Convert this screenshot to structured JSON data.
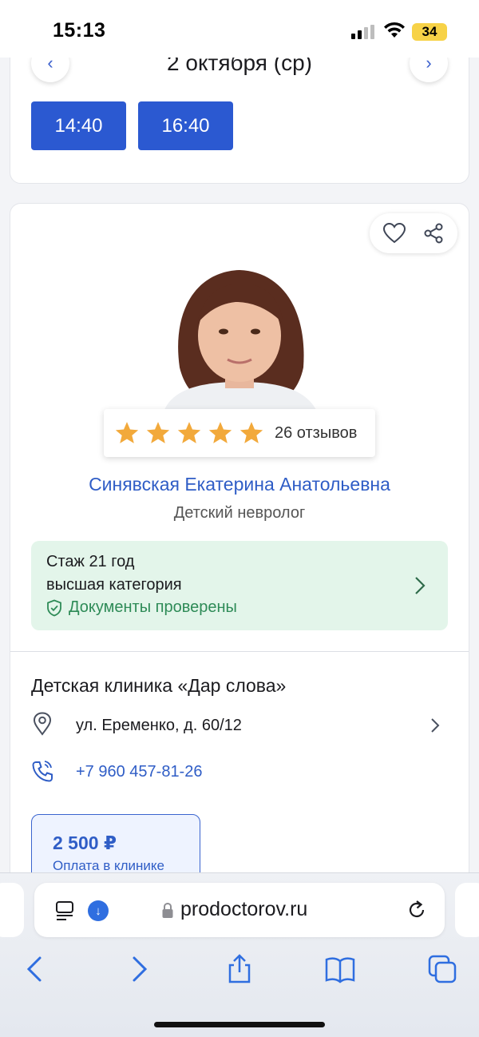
{
  "status": {
    "time": "15:13",
    "battery": "34"
  },
  "schedule": {
    "date": "2 октября (ср)",
    "slots": [
      "14:40",
      "16:40"
    ]
  },
  "doctor": {
    "reviews": "26 отзывов",
    "rating_stars": 5,
    "name": "Синявская Екатерина Анатольевна",
    "specialty": "Детский невролог",
    "experience": "Стаж 21 год",
    "category": "высшая категория",
    "verified": "Документы проверены"
  },
  "clinic": {
    "name": "Детская клиника «Дар слова»",
    "address": "ул. Еременко, д. 60/12",
    "phone": "+7 960 457-81-26",
    "price": "2 500 ₽",
    "payment_note": "Оплата в клинике"
  },
  "browser": {
    "url": "prodoctorov.ru"
  },
  "colors": {
    "accent": "#2b59d1",
    "link": "#2f5dc6",
    "star": "#f2a93b",
    "verified_bg": "#e3f5ea",
    "verified_text": "#2e8b57"
  },
  "icons": [
    "chevron-left-icon",
    "chevron-right-icon",
    "heart-icon",
    "share-icon",
    "star-icon",
    "shield-check-icon",
    "location-pin-icon",
    "phone-icon",
    "reader-icon",
    "download-icon",
    "lock-icon",
    "reload-icon",
    "back-icon",
    "forward-icon",
    "share-sheet-icon",
    "bookmarks-icon",
    "tabs-icon"
  ]
}
